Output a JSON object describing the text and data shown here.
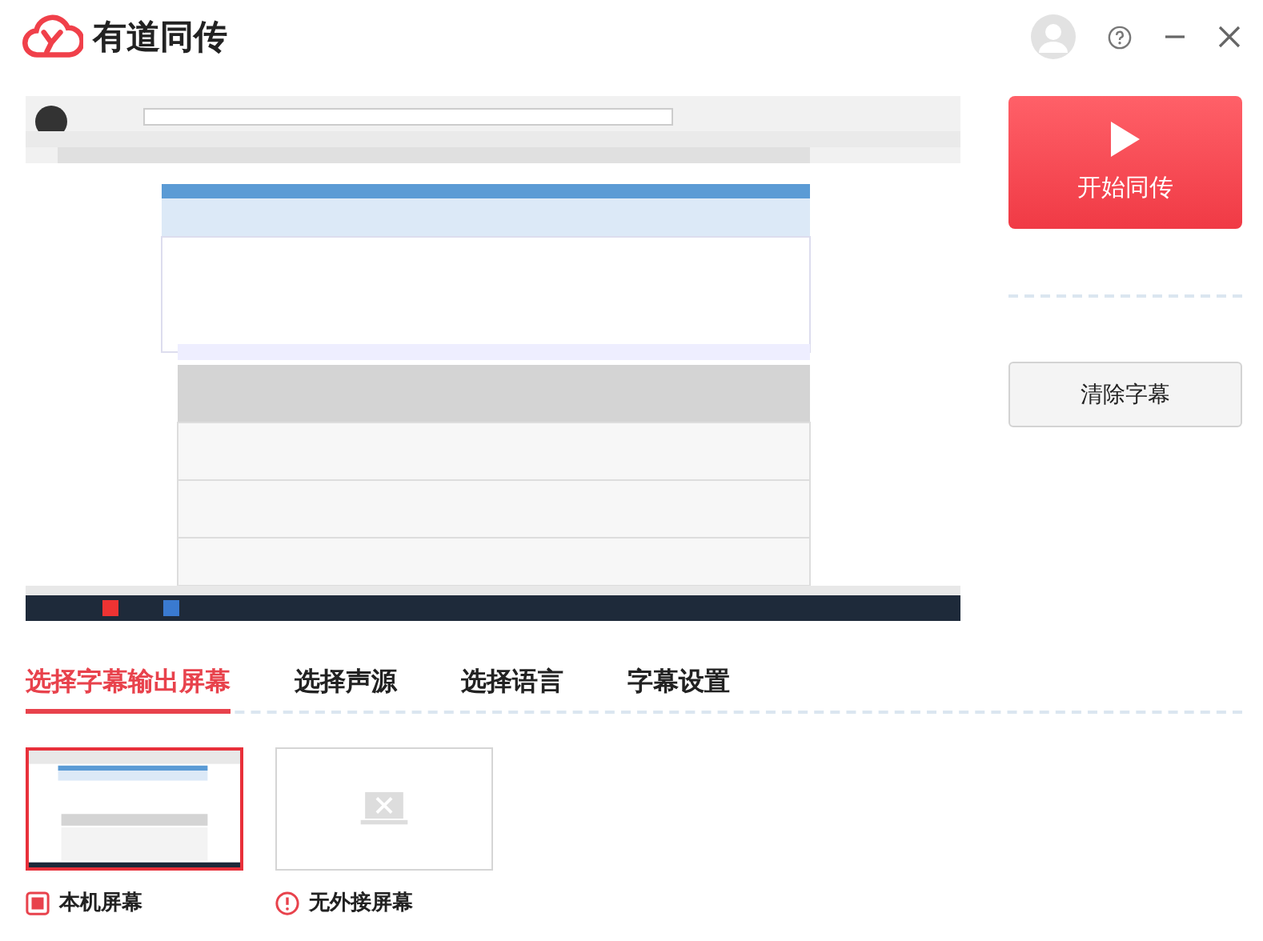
{
  "app": {
    "title": "有道同传"
  },
  "actions": {
    "start": "开始同传",
    "clear": "清除字幕"
  },
  "tabs": [
    {
      "label": "选择字幕输出屏幕",
      "selected": true
    },
    {
      "label": "选择声源",
      "selected": false
    },
    {
      "label": "选择语言",
      "selected": false
    },
    {
      "label": "字幕设置",
      "selected": false
    }
  ],
  "screens": [
    {
      "label": "本机屏幕",
      "kind": "local",
      "selected": true
    },
    {
      "label": "无外接屏幕",
      "kind": "missing",
      "selected": false
    }
  ]
}
